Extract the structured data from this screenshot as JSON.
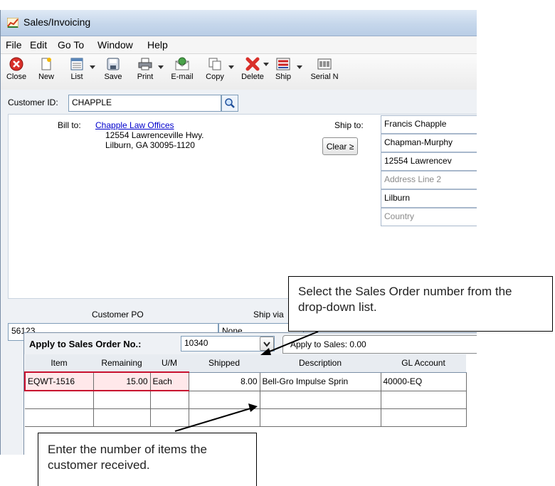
{
  "window": {
    "title": "Sales/Invoicing"
  },
  "menu": [
    "File",
    "Edit",
    "Go To",
    "Window",
    "Help"
  ],
  "toolbar": {
    "close": "Close",
    "new": "New",
    "list": "List",
    "save": "Save",
    "print": "Print",
    "email": "E-mail",
    "copy": "Copy",
    "delete": "Delete",
    "ship": "Ship",
    "serial": "Serial N"
  },
  "customer": {
    "label": "Customer ID:",
    "value": "CHAPPLE"
  },
  "bill_to": {
    "label": "Bill to:",
    "name": "Chapple Law Offices",
    "line1": "12554 Lawrenceville Hwy.",
    "line2": "Lilburn, GA 30095-1120"
  },
  "ship_to": {
    "label": "Ship to:",
    "clear": "Clear ≥",
    "fields": [
      "Francis Chapple",
      "Chapman-Murphy",
      "12554 Lawrencev",
      "Address Line 2",
      "Lilburn",
      "Country"
    ]
  },
  "customer_po": {
    "label": "Customer PO",
    "value": "56123"
  },
  "ship_via": {
    "label": "Ship via",
    "value": "None"
  },
  "apply": {
    "label": "Apply to Sales Order No.:",
    "value": "10340",
    "tab": "Apply to Sales: 0.00"
  },
  "table": {
    "headers": [
      "Item",
      "Remaining",
      "U/M",
      "Shipped",
      "Description",
      "GL Account"
    ],
    "rows": [
      [
        "EQWT-1516",
        "15.00",
        "Each",
        "8.00",
        "Bell-Gro Impulse Sprin",
        "40000-EQ"
      ]
    ]
  },
  "callouts": {
    "top": "Select the Sales Order number from the drop-down list.",
    "bottom": "Enter the number of items the customer received."
  }
}
